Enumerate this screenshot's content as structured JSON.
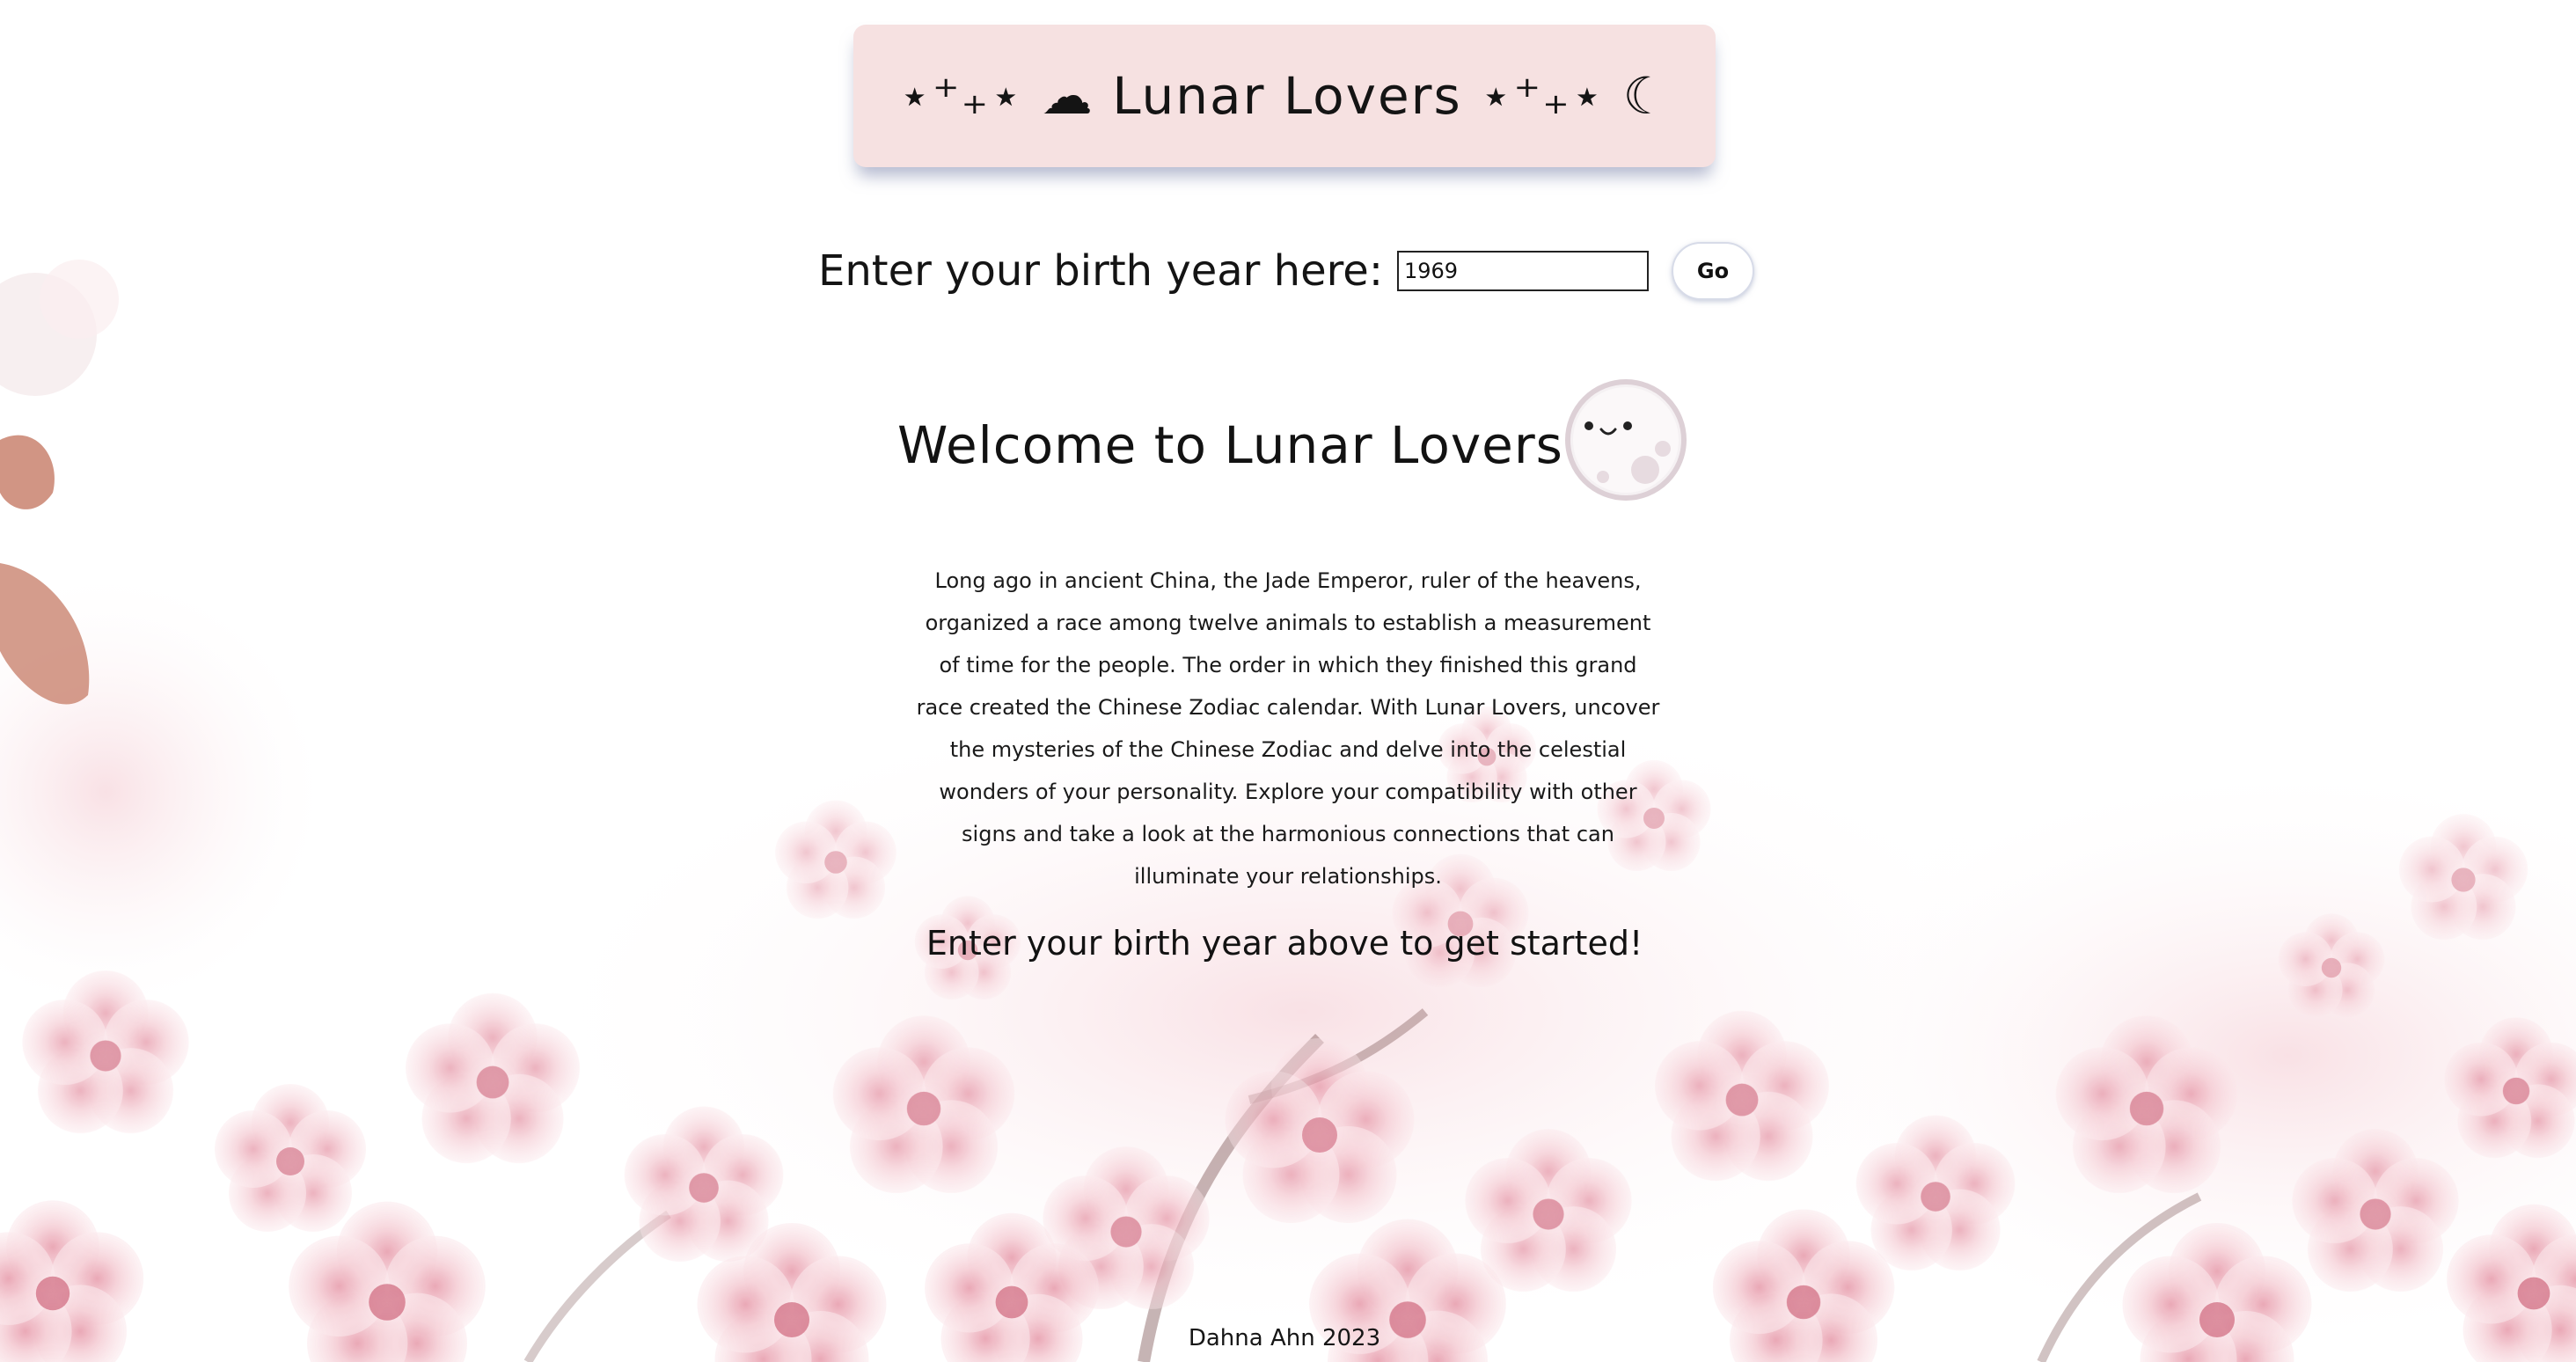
{
  "header": {
    "title": "⋆⁺₊⋆ ☁︎ Lunar Lovers ⋆⁺₊⋆ ☾"
  },
  "form": {
    "label": "Enter your birth year here:",
    "year_value": "1969",
    "go_label": "Go"
  },
  "main": {
    "welcome_heading": "Welcome to Lunar Lovers!",
    "moon_icon": "smiling-moon-icon",
    "intro": "Long ago in ancient China, the Jade Emperor, ruler of the heavens, organized a race among twelve animals to establish a measurement of time for the people. The order in which they finished this grand race created the Chinese Zodiac calendar. With Lunar Lovers, uncover the mysteries of the Chinese Zodiac and delve into the celestial wonders of your personality. Explore your compatibility with other signs and take a look at the harmonious connections that can illuminate your relationships.",
    "cta": "Enter your birth year above to get started!"
  },
  "footer": {
    "credit": "Dahna Ahn 2023"
  },
  "colors": {
    "banner_bg": "#f6e1e1",
    "blossom_pink": "#f2c3cc",
    "leaf_brown": "#c9836f"
  }
}
